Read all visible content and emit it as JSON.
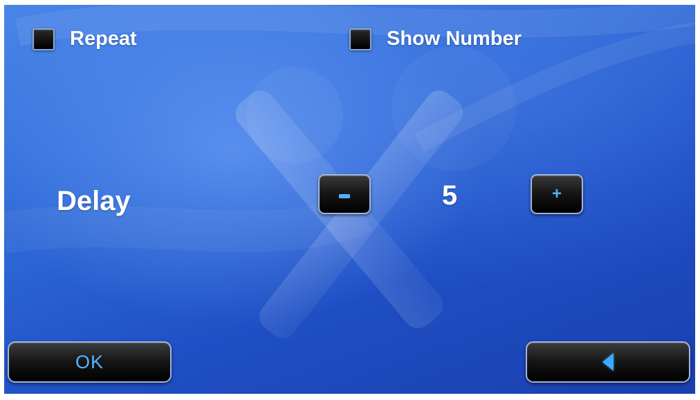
{
  "options": {
    "repeat": {
      "label": "Repeat",
      "checked": false
    },
    "show_number": {
      "label": "Show Number",
      "checked": false
    }
  },
  "delay": {
    "label": "Delay",
    "value": "5",
    "plus_label": "+"
  },
  "footer": {
    "ok_label": "OK",
    "back_icon": "back-arrow-icon"
  },
  "colors": {
    "background": "#2f6ad8",
    "button_glyph": "#4db1ff",
    "text": "#ffffff"
  }
}
